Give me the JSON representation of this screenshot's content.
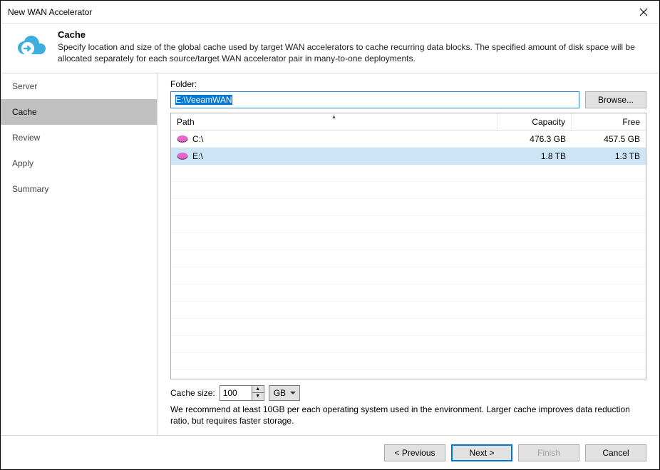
{
  "window": {
    "title": "New WAN Accelerator"
  },
  "header": {
    "title": "Cache",
    "desc": "Specify location and size of the global cache used by target WAN accelerators to cache recurring data blocks. The specified amount of disk space will be allocated separately for each source/target WAN accelerator pair in many-to-one deployments."
  },
  "nav": {
    "items": [
      {
        "label": "Server",
        "active": false
      },
      {
        "label": "Cache",
        "active": true
      },
      {
        "label": "Review",
        "active": false
      },
      {
        "label": "Apply",
        "active": false
      },
      {
        "label": "Summary",
        "active": false
      }
    ]
  },
  "folder": {
    "label": "Folder:",
    "value": "E:\\VeeamWAN",
    "browse": "Browse..."
  },
  "table": {
    "headers": {
      "path": "Path",
      "capacity": "Capacity",
      "free": "Free"
    },
    "rows": [
      {
        "path": "C:\\",
        "capacity": "476.3 GB",
        "free": "457.5 GB",
        "selected": false
      },
      {
        "path": "E:\\",
        "capacity": "1.8 TB",
        "free": "1.3 TB",
        "selected": true
      }
    ]
  },
  "cacheSize": {
    "label": "Cache size:",
    "value": "100",
    "unit": "GB",
    "hint": "We recommend at least 10GB per each operating system used in the environment. Larger cache improves data reduction ratio, but requires faster storage."
  },
  "footer": {
    "previous": "< Previous",
    "next": "Next >",
    "finish": "Finish",
    "cancel": "Cancel"
  }
}
